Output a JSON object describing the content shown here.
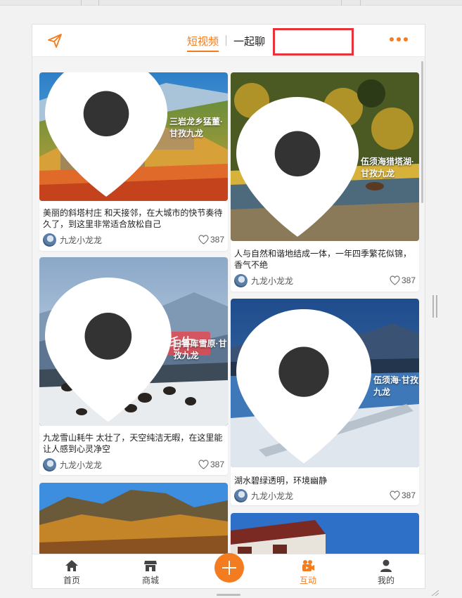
{
  "header": {
    "tabs": [
      {
        "label": "短视频",
        "active": true
      },
      {
        "label": "一起聊",
        "active": false
      }
    ]
  },
  "posts": [
    {
      "location": "三岩龙乡猛董·甘孜九龙",
      "description": "美丽的斜塔村庄 和天接邻，在大城市的快节奏待久了，到这里非常适合放松自己",
      "author": "九龙小龙龙",
      "likes": "387"
    },
    {
      "location": "日鲁库雪原·甘孜九龙",
      "overlay_text": "四川甘孜九龙牦牛",
      "description": "九龙雪山耗牛 太壮了，天空纯洁无暇，在这里能让人感到心灵净空",
      "author": "九龙小龙龙",
      "likes": "387"
    },
    {
      "location": "伍须海猎塔湖·甘孜九龙",
      "description": "人与自然和谐地结成一体，一年四季繁花似锦，香气不绝",
      "author": "九龙小龙龙",
      "likes": "387"
    },
    {
      "location": "伍须海·甘孜九龙",
      "description": "湖水碧绿透明，环境幽静",
      "author": "九龙小龙龙",
      "likes": "387"
    }
  ],
  "tabbar": {
    "items": [
      "首页",
      "商城",
      "互动",
      "我的"
    ],
    "active": "互动"
  },
  "colors": {
    "accent": "#f47c20",
    "highlight_box": "#e8323a"
  }
}
